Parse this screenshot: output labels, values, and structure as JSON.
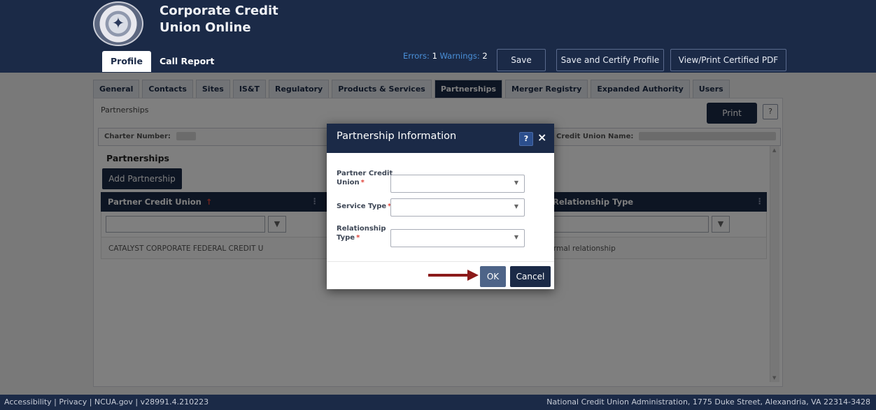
{
  "app": {
    "title": "Corporate Credit Union Online"
  },
  "nav": {
    "profile": "Profile",
    "call_report": "Call Report"
  },
  "status": {
    "errors_label": "Errors:",
    "errors_count": "1",
    "warnings_label": "Warnings:",
    "warnings_count": "2"
  },
  "header_buttons": {
    "save": "Save",
    "certify": "Save and Certify Profile",
    "view_pdf": "View/Print Certified PDF"
  },
  "sub_tabs": [
    "General",
    "Contacts",
    "Sites",
    "IS&T",
    "Regulatory",
    "Products & Services",
    "Partnerships",
    "Merger Registry",
    "Expanded Authority",
    "Users"
  ],
  "active_sub_tab": "Partnerships",
  "page": {
    "section_label": "Partnerships",
    "print": "Print",
    "help": "?",
    "charter_label": "Charter Number:",
    "cu_name_label": "Credit Union Name:",
    "grid_title": "Partnerships",
    "add_button": "Add Partnership",
    "columns": {
      "partner": "Partner Credit Union",
      "relationship": "Relationship Type"
    },
    "sort_indicator": "↑",
    "rows": [
      {
        "partner": "CATALYST CORPORATE FEDERAL CREDIT U",
        "relationship": "rmal relationship"
      }
    ]
  },
  "modal": {
    "title": "Partnership Information",
    "help": "?",
    "close": "×",
    "fields": [
      {
        "label_line1": "Partner Credit",
        "label_line2": "Union",
        "value": ""
      },
      {
        "label_line1": "Service Type",
        "label_line2": "",
        "value": ""
      },
      {
        "label_line1": "Relationship",
        "label_line2": "Type",
        "value": ""
      }
    ],
    "ok": "OK",
    "cancel": "Cancel"
  },
  "footer": {
    "left": "Accessibility | Privacy | NCUA.gov | v28991.4.210223",
    "right": "National Credit Union Administration, 1775 Duke Street, Alexandria, VA 22314-3428"
  },
  "colors": {
    "navy": "#1b2a47",
    "accent_link": "#4a90d9",
    "required": "#e0453c",
    "arrow": "#8b1a1a"
  }
}
